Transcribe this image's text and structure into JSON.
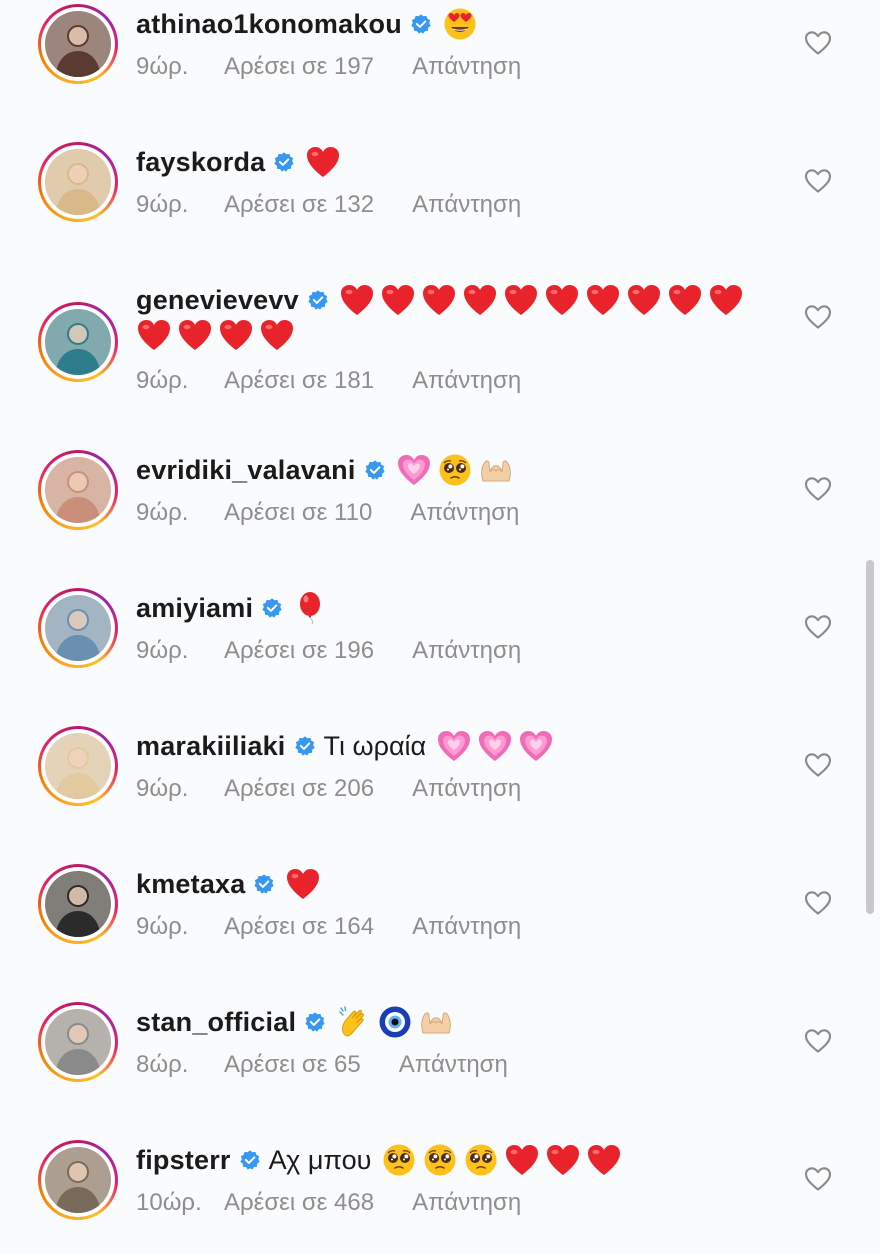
{
  "comments": [
    {
      "username": "athinao1konomakou",
      "text": "",
      "emojis": [
        "heart-eyes"
      ],
      "emojis_line2": [],
      "time": "9ώρ.",
      "likes": "Αρέσει σε 197",
      "reply": "Απάντηση",
      "avatar_color": "#5b3a32"
    },
    {
      "username": "fayskorda",
      "text": "",
      "emojis": [
        "red-heart"
      ],
      "emojis_line2": [],
      "time": "9ώρ.",
      "likes": "Αρέσει σε 132",
      "reply": "Απάντηση",
      "avatar_color": "#d9b98a"
    },
    {
      "username": "genevievevv",
      "text": "",
      "emojis": [
        "red-heart",
        "red-heart",
        "red-heart",
        "red-heart",
        "red-heart",
        "red-heart",
        "red-heart",
        "red-heart",
        "red-heart",
        "red-heart"
      ],
      "emojis_line2": [
        "red-heart",
        "red-heart",
        "red-heart",
        "red-heart"
      ],
      "time": "9ώρ.",
      "likes": "Αρέσει σε 181",
      "reply": "Απάντηση",
      "avatar_color": "#2e7d8c"
    },
    {
      "username": "evridiki_valavani",
      "text": "",
      "emojis": [
        "sparkling-heart",
        "pleading-face",
        "heart-hands"
      ],
      "emojis_line2": [],
      "time": "9ώρ.",
      "likes": "Αρέσει σε 110",
      "reply": "Απάντηση",
      "avatar_color": "#c98f7a"
    },
    {
      "username": "amiyiami",
      "text": "",
      "emojis": [
        "balloon"
      ],
      "emojis_line2": [],
      "time": "9ώρ.",
      "likes": "Αρέσει σε 196",
      "reply": "Απάντηση",
      "avatar_color": "#6a8fb0"
    },
    {
      "username": "marakiiliaki",
      "text": "Τι ωραία",
      "emojis": [
        "sparkling-heart",
        "sparkling-heart",
        "sparkling-heart"
      ],
      "emojis_line2": [],
      "time": "9ώρ.",
      "likes": "Αρέσει σε 206",
      "reply": "Απάντηση",
      "avatar_color": "#e2c9a0"
    },
    {
      "username": "kmetaxa",
      "text": "",
      "emojis": [
        "red-heart"
      ],
      "emojis_line2": [],
      "time": "9ώρ.",
      "likes": "Αρέσει σε 164",
      "reply": "Απάντηση",
      "avatar_color": "#2b2b2b"
    },
    {
      "username": "stan_official",
      "text": "",
      "emojis": [
        "clapping-hands",
        "nazar-amulet",
        "heart-hands"
      ],
      "emojis_line2": [],
      "time": "8ώρ.",
      "likes": "Αρέσει σε 65",
      "reply": "Απάντηση",
      "avatar_color": "#8a8a8a"
    },
    {
      "username": "fipsterr",
      "text": "Αχ μπου",
      "emojis": [
        "pleading-face",
        "pleading-face",
        "pleading-face",
        "red-heart",
        "red-heart",
        "red-heart"
      ],
      "emojis_line2": [],
      "time": "10ώρ.",
      "likes": "Αρέσει σε 468",
      "reply": "Απάντηση",
      "avatar_color": "#7a6a5a"
    }
  ],
  "colors": {
    "verified": "#3897f0",
    "meta_text": "#8e8e8e",
    "heart_red": "#e8232c"
  },
  "icons": {
    "like": "heart-outline-icon",
    "verified": "verified-badge-icon"
  }
}
